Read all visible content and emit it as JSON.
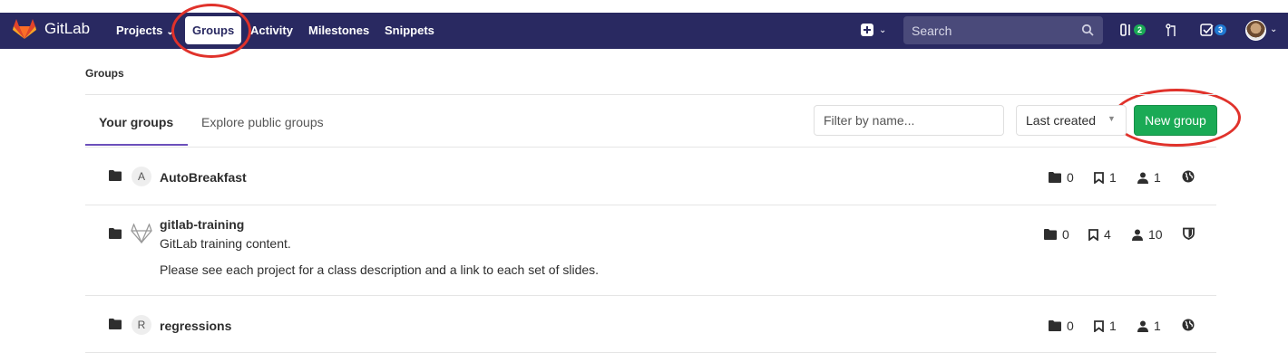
{
  "navbar": {
    "logo_text": "GitLab",
    "links": [
      {
        "label": "Projects"
      },
      {
        "label": "Groups"
      },
      {
        "label": "Activity"
      },
      {
        "label": "Milestones"
      },
      {
        "label": "Snippets"
      }
    ],
    "search_placeholder": "Search",
    "issues_count": "2",
    "todos_count": "3"
  },
  "breadcrumb": "Groups",
  "tabs": [
    {
      "label": "Your groups"
    },
    {
      "label": "Explore public groups"
    }
  ],
  "filter_placeholder": "Filter by name...",
  "sort_label": "Last created",
  "new_group_label": "New group",
  "groups": [
    {
      "avatar_letter": "A",
      "name": "AutoBreakfast",
      "description": "",
      "extra": "",
      "subgroups": "0",
      "projects": "1",
      "members": "1",
      "visibility_icon": "globe-icon"
    },
    {
      "avatar_letter": "",
      "name": "gitlab-training",
      "description": "GitLab training content.",
      "extra": "Please see each project for a class description and a link to each set of slides.",
      "subgroups": "0",
      "projects": "4",
      "members": "10",
      "visibility_icon": "shield-icon"
    },
    {
      "avatar_letter": "R",
      "name": "regressions",
      "description": "",
      "extra": "",
      "subgroups": "0",
      "projects": "1",
      "members": "1",
      "visibility_icon": "globe-icon"
    }
  ],
  "colors": {
    "navbar": "#292961",
    "primary_button": "#1aaa55",
    "tab_underline": "#6b4fbb",
    "annotation": "#e0322b"
  }
}
